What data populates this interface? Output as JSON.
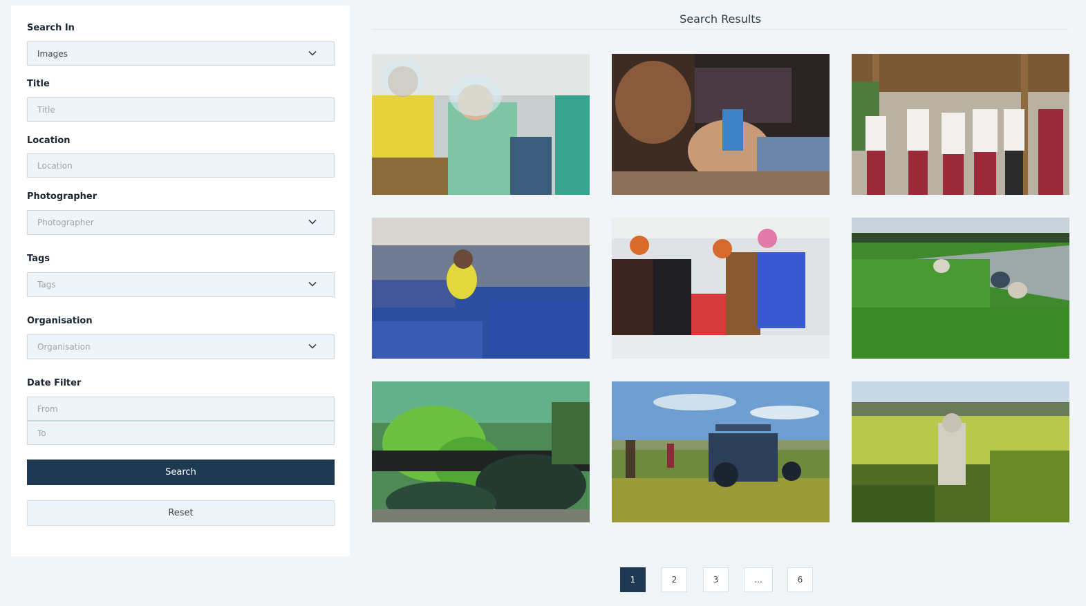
{
  "filters": {
    "search_in": {
      "label": "Search In",
      "value": "Images"
    },
    "title": {
      "label": "Title",
      "placeholder": "Title"
    },
    "location": {
      "label": "Location",
      "placeholder": "Location"
    },
    "photographer": {
      "label": "Photographer",
      "placeholder": "Photographer"
    },
    "tags": {
      "label": "Tags",
      "placeholder": "Tags"
    },
    "organisation": {
      "label": "Organisation",
      "placeholder": "Organisation"
    },
    "date_filter": {
      "label": "Date Filter",
      "from_placeholder": "From",
      "to_placeholder": "To"
    },
    "search_label": "Search",
    "reset_label": "Reset"
  },
  "results": {
    "title": "Search Results",
    "images": [
      {
        "subject": "garment workers with face shields"
      },
      {
        "subject": "hands sewing fabric"
      },
      {
        "subject": "group of women walking"
      },
      {
        "subject": "garment factory floor"
      },
      {
        "subject": "group around sewing machine"
      },
      {
        "subject": "workers planting rice paddy"
      },
      {
        "subject": "seedlings in bottle planters"
      },
      {
        "subject": "tractor in field"
      },
      {
        "subject": "farmer in tall rice crop"
      }
    ]
  },
  "pagination": {
    "pages": [
      "1",
      "2",
      "3",
      "...",
      "6"
    ],
    "active": "1"
  },
  "colors": {
    "primary": "#1d3a52",
    "background": "#f2f5f8",
    "input_bg": "#eef4f7"
  }
}
